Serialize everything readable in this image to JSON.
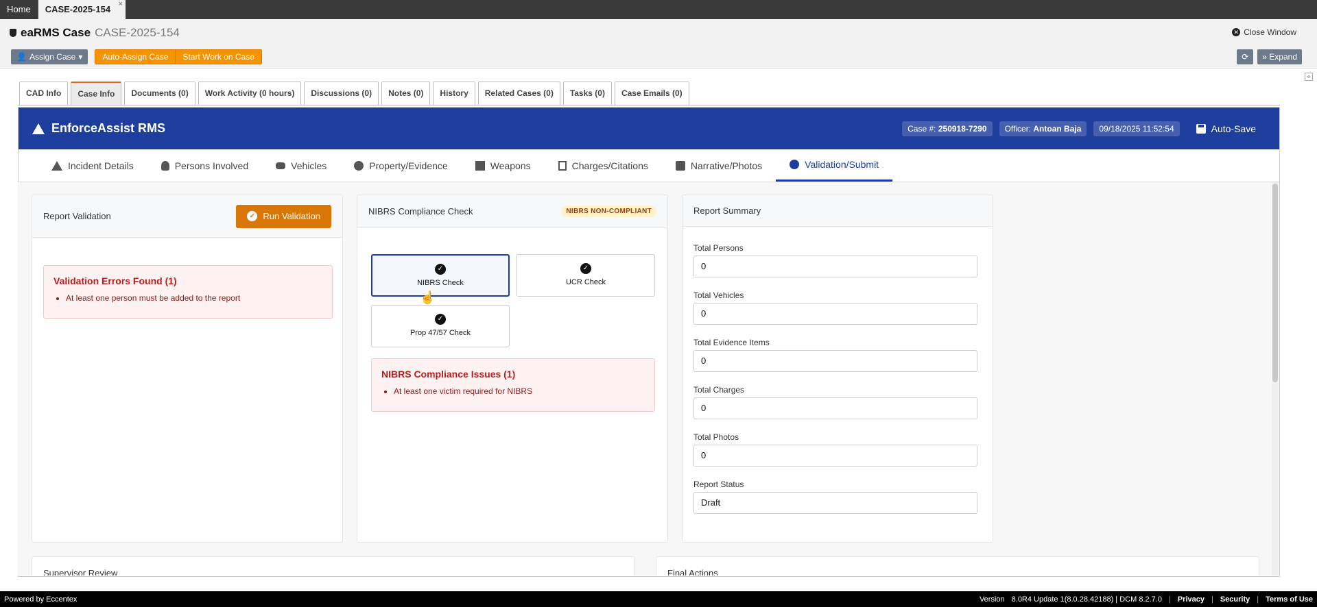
{
  "topbar": {
    "home": "Home",
    "case_tab": "CASE-2025-154",
    "close": "×"
  },
  "header": {
    "app_name": "eaRMS Case",
    "case_id": "CASE-2025-154",
    "close_window": "Close Window",
    "assign_case": "Assign Case",
    "auto_assign": "Auto-Assign Case",
    "start_work": "Start Work on Case",
    "expand": "Expand"
  },
  "tabs": [
    {
      "label": "CAD Info"
    },
    {
      "label": "Case Info"
    },
    {
      "label": "Documents (0)"
    },
    {
      "label": "Work Activity (0 hours)"
    },
    {
      "label": "Discussions (0)"
    },
    {
      "label": "Notes (0)"
    },
    {
      "label": "History"
    },
    {
      "label": "Related Cases (0)"
    },
    {
      "label": "Tasks (0)"
    },
    {
      "label": "Case Emails (0)"
    }
  ],
  "app": {
    "brand": "EnforceAssist RMS",
    "case_label": "Case #:",
    "case_number": "250918-7290",
    "officer_label": "Officer:",
    "officer_name": "Antoan Baja",
    "datetime": "09/18/2025 11:52:54",
    "autosave": "Auto-Save",
    "accent": "#1e3e9e"
  },
  "subnav": [
    {
      "label": "Incident Details",
      "icon": "warning-icon"
    },
    {
      "label": "Persons Involved",
      "icon": "person-icon"
    },
    {
      "label": "Vehicles",
      "icon": "car-icon"
    },
    {
      "label": "Property/Evidence",
      "icon": "gear-icon"
    },
    {
      "label": "Weapons",
      "icon": "weapon-icon"
    },
    {
      "label": "Charges/Citations",
      "icon": "document-icon"
    },
    {
      "label": "Narrative/Photos",
      "icon": "notes-icon"
    },
    {
      "label": "Validation/Submit",
      "icon": "check-circle-icon"
    }
  ],
  "validation": {
    "title": "Report Validation",
    "run_button": "Run Validation",
    "error_title": "Validation Errors Found (1)",
    "errors": [
      "At least one person must be added to the report"
    ]
  },
  "nibrs": {
    "title": "NIBRS Compliance Check",
    "badge": "NIBRS NON-COMPLIANT",
    "checks": [
      "NIBRS Check",
      "UCR Check",
      "Prop 47/57 Check"
    ],
    "issues_title": "NIBRS Compliance Issues (1)",
    "issues": [
      "At least one victim required for NIBRS"
    ]
  },
  "summary": {
    "title": "Report Summary",
    "fields": [
      {
        "label": "Total Persons",
        "value": "0"
      },
      {
        "label": "Total Vehicles",
        "value": "0"
      },
      {
        "label": "Total Evidence Items",
        "value": "0"
      },
      {
        "label": "Total Charges",
        "value": "0"
      },
      {
        "label": "Total Photos",
        "value": "0"
      },
      {
        "label": "Report Status",
        "value": "Draft"
      }
    ]
  },
  "lower": {
    "supervisor": "Supervisor Review",
    "final": "Final Actions"
  },
  "footer": {
    "powered": "Powered by Eccentex",
    "version_label": "Version",
    "version": "8.0R4 Update 1(8.0.28.42188) | DCM 8.2.7.0",
    "privacy": "Privacy",
    "security": "Security",
    "terms": "Terms of Use"
  }
}
